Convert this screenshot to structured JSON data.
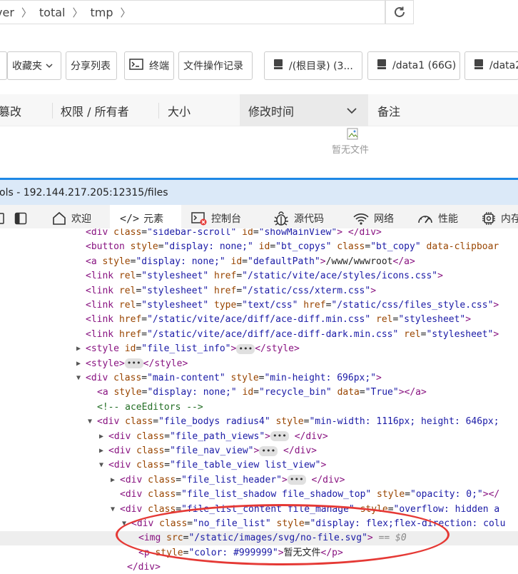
{
  "path": {
    "crumbs": [
      "ver",
      "total",
      "tmp"
    ],
    "sep": "〉"
  },
  "toolbar": {
    "favorites": "收藏夹",
    "share_list": "分享列表",
    "terminal": "终端",
    "file_log": "文件操作记录",
    "disk_root": "/(根目录) (3...",
    "disk_data1": "/data1 (66G)",
    "disk_data2": "/data2"
  },
  "columns": {
    "tamper": "篡改",
    "perm": "权限 / 所有者",
    "size": "大小",
    "mtime": "修改时间",
    "note": "备注"
  },
  "empty": {
    "text": "暂无文件"
  },
  "devtools": {
    "title": "ols - 192.144.217.205:12315/files",
    "tabs": {
      "welcome": "欢迎",
      "elements": "元素",
      "console": "控制台",
      "sources": "源代码",
      "network": "网络",
      "performance": "性能",
      "memory": "内存"
    }
  },
  "code_lines": [
    {
      "indent": 120,
      "html": "<span class='tag'>&lt;div</span> <span class='attr'>class</span><span class='eq'>=</span><span class='val'>\"sidebar-scroll\"</span> <span class='attr'>id</span><span class='eq'>=</span><span class='val'>\"showMainView\"</span><span class='tag'>&gt;</span> <span class='tag'>&lt;/div&gt;</span>"
    },
    {
      "indent": 120,
      "html": "<span class='tag'>&lt;button</span> <span class='attr'>style</span><span class='eq'>=</span><span class='val'>\"display: none;\"</span> <span class='attr'>id</span><span class='eq'>=</span><span class='val'>\"bt_copys\"</span> <span class='attr'>class</span><span class='eq'>=</span><span class='val'>\"bt_copy\"</span> <span class='attr'>data-clipboar</span>"
    },
    {
      "indent": 120,
      "html": "<span class='tag'>&lt;a</span> <span class='attr'>style</span><span class='eq'>=</span><span class='val'>\"display: none;\"</span> <span class='attr'>id</span><span class='eq'>=</span><span class='val'>\"defaultPath\"</span><span class='tag'>&gt;</span><span class='txt'>/www/wwwroot</span><span class='tag'>&lt;/a&gt;</span>"
    },
    {
      "indent": 120,
      "html": "<span class='tag'>&lt;link</span> <span class='attr'>rel</span><span class='eq'>=</span><span class='val'>\"stylesheet\"</span> <span class='attr'>href</span><span class='eq'>=</span><span class='val'>\"/static/vite/ace/styles/icons.css\"</span><span class='tag'>&gt;</span>"
    },
    {
      "indent": 120,
      "html": "<span class='tag'>&lt;link</span> <span class='attr'>rel</span><span class='eq'>=</span><span class='val'>\"stylesheet\"</span> <span class='attr'>href</span><span class='eq'>=</span><span class='val'>\"/static/css/xterm.css\"</span><span class='tag'>&gt;</span>"
    },
    {
      "indent": 120,
      "html": "<span class='tag'>&lt;link</span> <span class='attr'>rel</span><span class='eq'>=</span><span class='val'>\"stylesheet\"</span> <span class='attr'>type</span><span class='eq'>=</span><span class='val'>\"text/css\"</span> <span class='attr'>href</span><span class='eq'>=</span><span class='val'>\"/static/css/files_style.css\"</span><span class='tag'>&gt;</span>"
    },
    {
      "indent": 120,
      "html": "<span class='tag'>&lt;link</span> <span class='attr'>href</span><span class='eq'>=</span><span class='val'>\"/static/vite/ace/diff/ace-diff.min.css\"</span> <span class='attr'>rel</span><span class='eq'>=</span><span class='val'>\"stylesheet\"</span><span class='tag'>&gt;</span>"
    },
    {
      "indent": 120,
      "html": "<span class='tag'>&lt;link</span> <span class='attr'>href</span><span class='eq'>=</span><span class='val'>\"/static/vite/ace/diff/ace-diff-dark.min.css\"</span> <span class='attr'>rel</span><span class='eq'>=</span><span class='val'>\"stylesheet\"</span><span class='tag'>&gt;</span>"
    },
    {
      "indent": 120,
      "tri": "▶",
      "html": "<span class='tag'>&lt;style</span> <span class='attr'>id</span><span class='eq'>=</span><span class='val'>\"file_list_info\"</span><span class='tag'>&gt;</span><span class='dots'>•••</span><span class='tag'>&lt;/style&gt;</span>"
    },
    {
      "indent": 120,
      "tri": "▶",
      "html": "<span class='tag'>&lt;style&gt;</span><span class='dots'>•••</span><span class='tag'>&lt;/style&gt;</span>"
    },
    {
      "indent": 120,
      "tri": "▼",
      "html": "<span class='tag'>&lt;div</span> <span class='attr'>class</span><span class='eq'>=</span><span class='val'>\"main-content\"</span> <span class='attr'>style</span><span class='eq'>=</span><span class='val'>\"min-height: 696px;\"</span><span class='tag'>&gt;</span>"
    },
    {
      "indent": 136,
      "html": "<span class='tag'>&lt;a</span> <span class='attr'>style</span><span class='eq'>=</span><span class='val'>\"display: none;\"</span> <span class='attr'>id</span><span class='eq'>=</span><span class='val'>\"recycle_bin\"</span> <span class='attr'>data</span><span class='eq'>=</span><span class='val'>\"True\"</span><span class='tag'>&gt;&lt;/a&gt;</span>"
    },
    {
      "indent": 136,
      "html": "<span class='cmt'>&lt;!-- aceEditors --&gt;</span>"
    },
    {
      "indent": 136,
      "tri": "▼",
      "html": "<span class='tag'>&lt;div</span> <span class='attr'>class</span><span class='eq'>=</span><span class='val'>\"file_bodys radius4\"</span> <span class='attr'>style</span><span class='eq'>=</span><span class='val'>\"min-width: 1116px; height: 646px;</span>"
    },
    {
      "indent": 152,
      "tri": "▶",
      "html": "<span class='tag'>&lt;div</span> <span class='attr'>class</span><span class='eq'>=</span><span class='val'>\"file_path_views\"</span><span class='tag'>&gt;</span><span class='dots'>•••</span> <span class='tag'>&lt;/div&gt;</span>"
    },
    {
      "indent": 152,
      "tri": "▶",
      "html": "<span class='tag'>&lt;div</span> <span class='attr'>class</span><span class='eq'>=</span><span class='val'>\"file_nav_view\"</span><span class='tag'>&gt;</span><span class='dots'>•••</span> <span class='tag'>&lt;/div&gt;</span>"
    },
    {
      "indent": 152,
      "tri": "▼",
      "html": "<span class='tag'>&lt;div</span> <span class='attr'>class</span><span class='eq'>=</span><span class='val'>\"file_table_view list_view\"</span><span class='tag'>&gt;</span>"
    },
    {
      "indent": 168,
      "tri": "▶",
      "html": "<span class='tag'>&lt;div</span> <span class='attr'>class</span><span class='eq'>=</span><span class='val'>\"file_list_header\"</span><span class='tag'>&gt;</span><span class='dots'>•••</span> <span class='tag'>&lt;/div&gt;</span>"
    },
    {
      "indent": 168,
      "html": "<span class='tag'>&lt;div</span> <span class='attr'>class</span><span class='eq'>=</span><span class='val'>\"file_list_shadow file_shadow_top\"</span> <span class='attr'>style</span><span class='eq'>=</span><span class='val'>\"opacity: 0;\"</span><span class='tag'>&gt;&lt;/</span>"
    },
    {
      "indent": 168,
      "tri": "▼",
      "html": "<span class='tag'>&lt;div</span> <span class='attr'>class</span><span class='eq'>=</span><span class='val'>\"file_list_content file_manage\"</span> <span class='attr'>style</span><span class='eq'>=</span><span class='val'>\"overflow: hidden a</span>"
    },
    {
      "indent": 184,
      "tri": "▼",
      "html": "<span class='tag'>&lt;div</span> <span class='attr'>class</span><span class='eq'>=</span><span class='val'>\"no_file_list\"</span> <span class='attr'>style</span><span class='eq'>=</span><span class='val'>\"display: flex;flex-direction: colu</span>"
    },
    {
      "indent": 194,
      "hl": true,
      "html": "<span class='tag'>&lt;img</span> <span class='attr'>src</span><span class='eq'>=</span><span class='val'>\"/static/images/svg/no-file.svg\"</span><span class='tag'>&gt;</span> <span class='dim'>== $0</span>"
    },
    {
      "indent": 194,
      "html": "<span class='tag'>&lt;p</span> <span class='attr'>style</span><span class='eq'>=</span><span class='val'>\"color: #999999\"</span><span class='tag'>&gt;</span><span class='txt'>暂无文件</span><span class='tag'>&lt;/p&gt;</span>"
    },
    {
      "indent": 178,
      "html": "<span class='tag'>&lt;/div&gt;</span>"
    }
  ]
}
